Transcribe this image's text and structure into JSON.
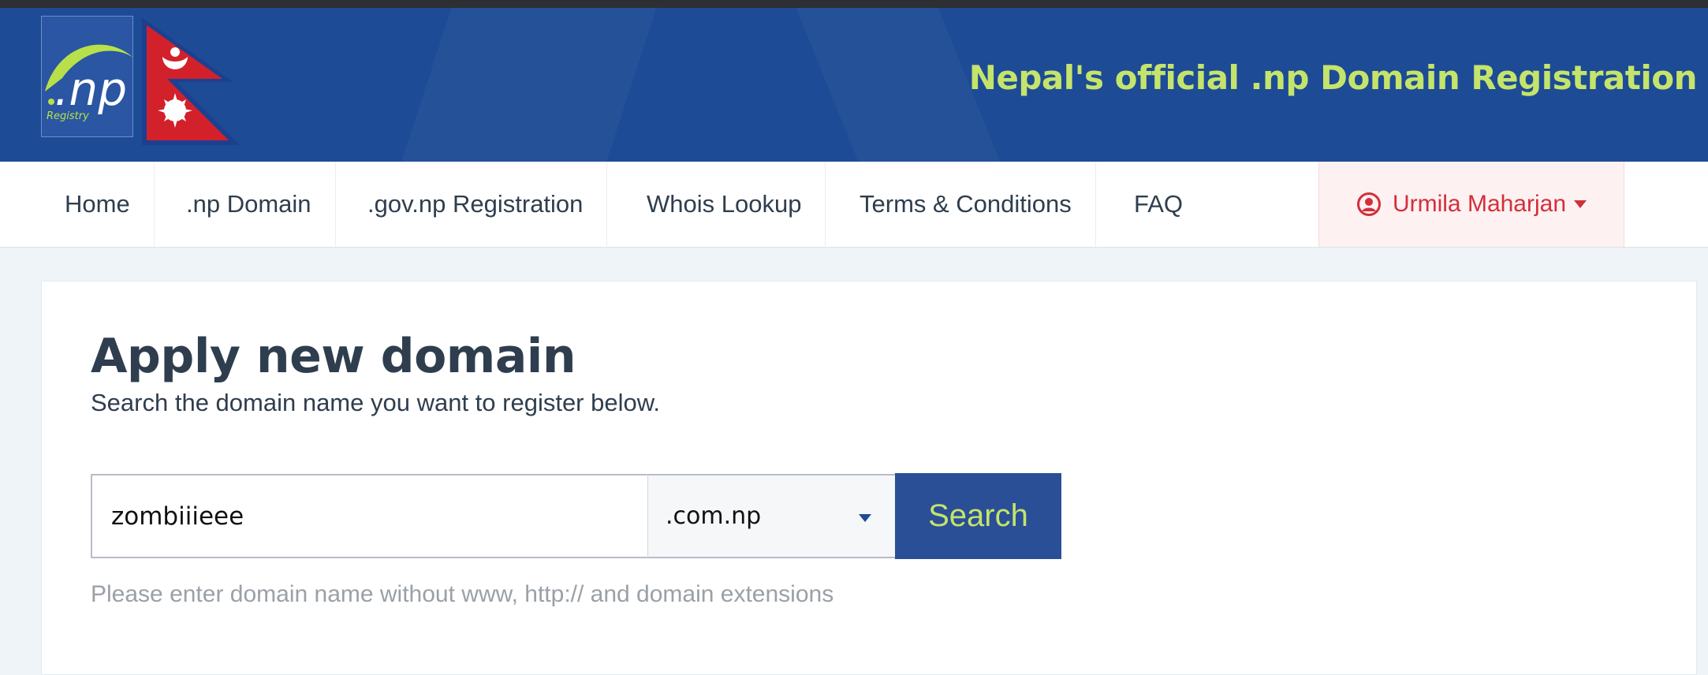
{
  "header": {
    "logo_text": ".np",
    "logo_subtext": "Registry",
    "title": "Nepal's official .np Domain Registration"
  },
  "nav": {
    "items": [
      {
        "label": "Home"
      },
      {
        "label": ".np Domain"
      },
      {
        "label": ".gov.np Registration"
      },
      {
        "label": "Whois Lookup"
      },
      {
        "label": "Terms & Conditions"
      },
      {
        "label": "FAQ"
      }
    ],
    "user": {
      "name": "Urmila Maharjan",
      "icon": "user-circle-icon"
    }
  },
  "main": {
    "title": "Apply new domain",
    "subtitle": "Search the domain name you want to register below.",
    "search": {
      "value": "zombiiieee",
      "extension": ".com.np",
      "button_label": "Search",
      "helper": "Please enter domain name without www, http:// and domain extensions"
    }
  },
  "colors": {
    "header_bg": "#1e4b95",
    "accent_green": "#c4e46b",
    "text_dark": "#2f3e4e",
    "user_red": "#d32f3a"
  }
}
